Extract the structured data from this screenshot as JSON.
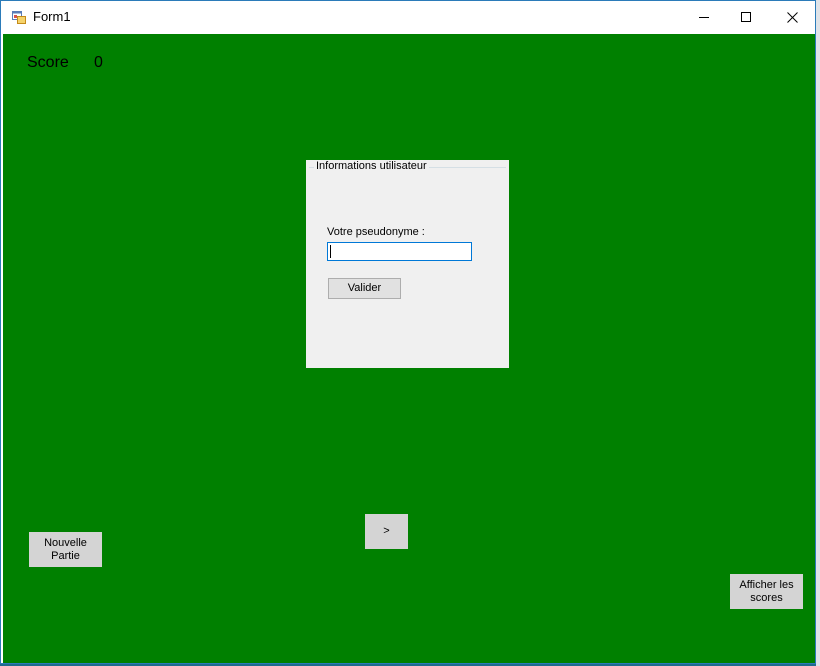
{
  "window": {
    "title": "Form1",
    "icon": "winforms-app-icon",
    "controls": {
      "minimize_icon": "minimize-icon",
      "maximize_icon": "maximize-icon",
      "close_icon": "close-icon"
    }
  },
  "colors": {
    "client_background": "#008000",
    "panel_background": "#f0f0f0",
    "button_background": "#d4d4d4",
    "input_border": "#0078d7"
  },
  "score": {
    "label": "Score",
    "value": "0"
  },
  "user_panel": {
    "title": "Informations utilisateur",
    "pseudo_label": "Votre pseudonyme :",
    "pseudo_value": "",
    "validate_label": "Valider"
  },
  "buttons": {
    "new_game": "Nouvelle Partie",
    "next": ">",
    "show_scores": "Afficher les scores"
  }
}
